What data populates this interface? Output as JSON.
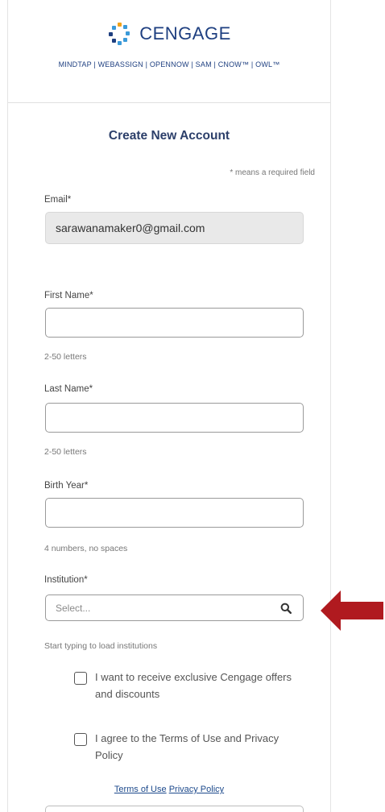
{
  "header": {
    "brand": "CENGAGE",
    "product_line": "MINDTAP | WEBASSIGN | OPENNOW | SAM | CNOW™ | OWL™"
  },
  "form": {
    "title": "Create New Account",
    "required_note": "* means a required field",
    "email": {
      "label": "Email*",
      "value": "sarawanamaker0@gmail.com"
    },
    "first_name": {
      "label": "First Name*",
      "value": "",
      "hint": "2-50 letters"
    },
    "last_name": {
      "label": "Last Name*",
      "value": "",
      "hint": "2-50 letters"
    },
    "birth_year": {
      "label": "Birth Year*",
      "value": "",
      "hint": "4 numbers, no spaces"
    },
    "institution": {
      "label": "Institution*",
      "placeholder": "Select...",
      "hint": "Start typing to load institutions"
    },
    "offers_checkbox": {
      "label": "I want to receive exclusive Cengage offers and discounts",
      "checked": false
    },
    "terms_checkbox": {
      "label": "I agree to the Terms of Use and Privacy Policy",
      "checked": false
    },
    "links": {
      "terms": "Terms of Use",
      "privacy": "Privacy Policy"
    }
  },
  "colors": {
    "brand_blue": "#1e3f80",
    "arrow_red": "#b01a1f"
  },
  "icons": {
    "institution_search": "search-icon",
    "annotation": "arrow-left-icon"
  }
}
